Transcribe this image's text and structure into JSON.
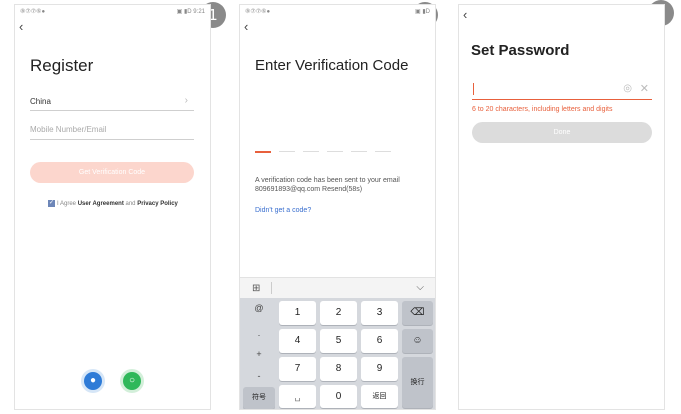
{
  "steps": [
    "1",
    "2",
    "3"
  ],
  "status_bar": {
    "left": "⑧⑦⑦⑥●",
    "right_s1": "▣ ▮D 9:21",
    "right_s2": "▣ ▮D"
  },
  "back_glyph": "‹",
  "register": {
    "title": "Register",
    "country": "China",
    "chevron": "›",
    "account_placeholder": "Mobile Number/Email",
    "get_code_button": "Get Verification Code",
    "agree_prefix": "I Agree",
    "user_agreement": "User Agreement",
    "and": "and",
    "privacy_policy": "Privacy Policy",
    "check_glyph": "✓",
    "social_icons": [
      "qq-icon",
      "wechat-icon"
    ]
  },
  "verify": {
    "title": "Enter Verification Code",
    "sent_message": "A verification code has been sent to your email 809691893@qq.com Resend(58s)",
    "no_code_link": "Didn't get a code?",
    "toolbar_grid_glyph": "⊞",
    "toolbar_hide_glyph": "⌵",
    "keys": {
      "at": "@",
      "dot": ".",
      "plus": "+",
      "minus": "-",
      "symbols": "符号",
      "k1": "1",
      "k2": "2",
      "k3": "3",
      "k4": "4",
      "k5": "5",
      "k6": "6",
      "k7": "7",
      "k8": "8",
      "k9": "9",
      "space": "␣",
      "k0": "0",
      "back_cn": "返回",
      "delete": "⌫",
      "emoji": "☺",
      "enter": "换行"
    }
  },
  "set_password": {
    "title": "Set Password",
    "eye_glyph": "◎",
    "clear_glyph": "✕",
    "hint": "6 to 20 characters, including letters and digits",
    "done_button": "Done"
  },
  "colors": {
    "accent": "#e8603c",
    "disabled_button": "#fcd6cd",
    "link": "#3a6fcf"
  }
}
